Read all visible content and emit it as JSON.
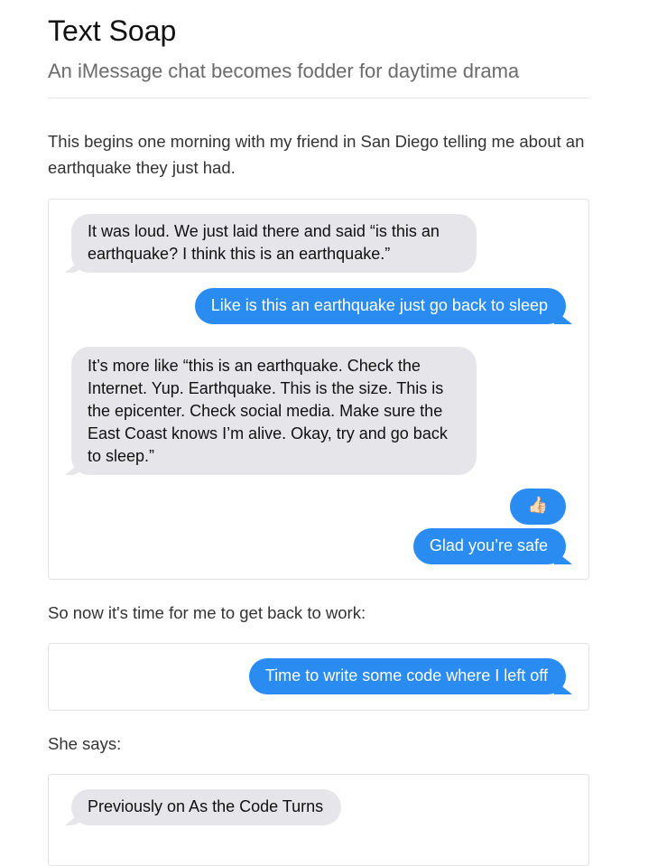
{
  "title": "Text Soap",
  "subtitle": "An iMessage chat becomes fodder for daytime drama",
  "intro": "This begins one morning with my friend in San Diego telling me about an earthquake they just had.",
  "chat1": [
    "It was loud. We just laid there and said “is this an earthquake? I think this is an earthquake.”",
    "Like is this an earthquake just go back to sleep",
    "It’s more like “this is an earthquake. Check the Internet. Yup. Earthquake. This is the size. This is the epicenter. Check social media. Make sure the East Coast knows I’m alive. Okay, try and go back to sleep.”",
    "👍🏻",
    "Glad you’re safe"
  ],
  "para2": "So now it's time for me to get back to work:",
  "chat2": [
    "Time to write some code where I left off"
  ],
  "para3": "She says:",
  "chat3": [
    "Previously on As the Code Turns"
  ]
}
